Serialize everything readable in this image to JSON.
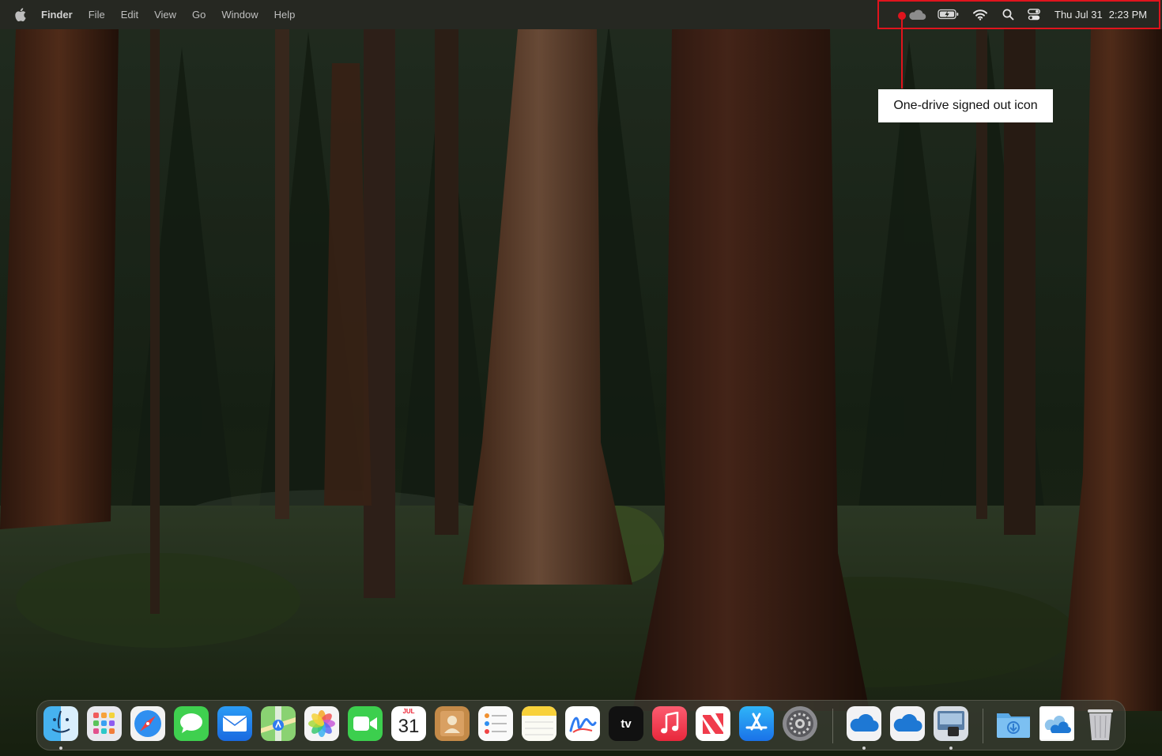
{
  "menubar": {
    "apple_icon": "apple-logo-icon",
    "app_name": "Finder",
    "menus": [
      "File",
      "Edit",
      "View",
      "Go",
      "Window",
      "Help"
    ],
    "status_icons": [
      "onedrive-cloud-icon",
      "battery-charging-icon",
      "wifi-icon",
      "spotlight-search-icon",
      "control-center-icon"
    ],
    "date": "Thu Jul 31",
    "time": "2:23 PM"
  },
  "annotation": {
    "label": "One-drive signed out icon",
    "color": "#e0141d"
  },
  "dock": {
    "apps": [
      {
        "name": "Finder",
        "icon": "finder-icon"
      },
      {
        "name": "Launchpad",
        "icon": "launchpad-icon"
      },
      {
        "name": "Safari",
        "icon": "safari-icon"
      },
      {
        "name": "Messages",
        "icon": "messages-icon"
      },
      {
        "name": "Mail",
        "icon": "mail-icon"
      },
      {
        "name": "Maps",
        "icon": "maps-icon"
      },
      {
        "name": "Photos",
        "icon": "photos-icon"
      },
      {
        "name": "FaceTime",
        "icon": "facetime-icon"
      },
      {
        "name": "Calendar",
        "icon": "calendar-icon"
      },
      {
        "name": "Contacts",
        "icon": "contacts-icon"
      },
      {
        "name": "Reminders",
        "icon": "reminders-icon"
      },
      {
        "name": "Notes",
        "icon": "notes-icon"
      },
      {
        "name": "Freeform",
        "icon": "freeform-icon"
      },
      {
        "name": "TV",
        "icon": "apple-tv-icon"
      },
      {
        "name": "Music",
        "icon": "music-icon"
      },
      {
        "name": "News",
        "icon": "news-icon"
      },
      {
        "name": "App Store",
        "icon": "app-store-icon"
      },
      {
        "name": "System Settings",
        "icon": "system-settings-icon"
      },
      {
        "name": "OneDrive",
        "icon": "onedrive-icon"
      },
      {
        "name": "OneDrive",
        "icon": "onedrive-icon"
      },
      {
        "name": "Preview",
        "icon": "preview-icon"
      },
      {
        "name": "Downloads",
        "icon": "downloads-folder-icon"
      },
      {
        "name": "Screenshot",
        "icon": "screenshot-file-icon"
      },
      {
        "name": "Trash",
        "icon": "trash-icon"
      }
    ],
    "calendar": {
      "month": "JUL",
      "day": "31"
    },
    "tv_label": "tv"
  }
}
